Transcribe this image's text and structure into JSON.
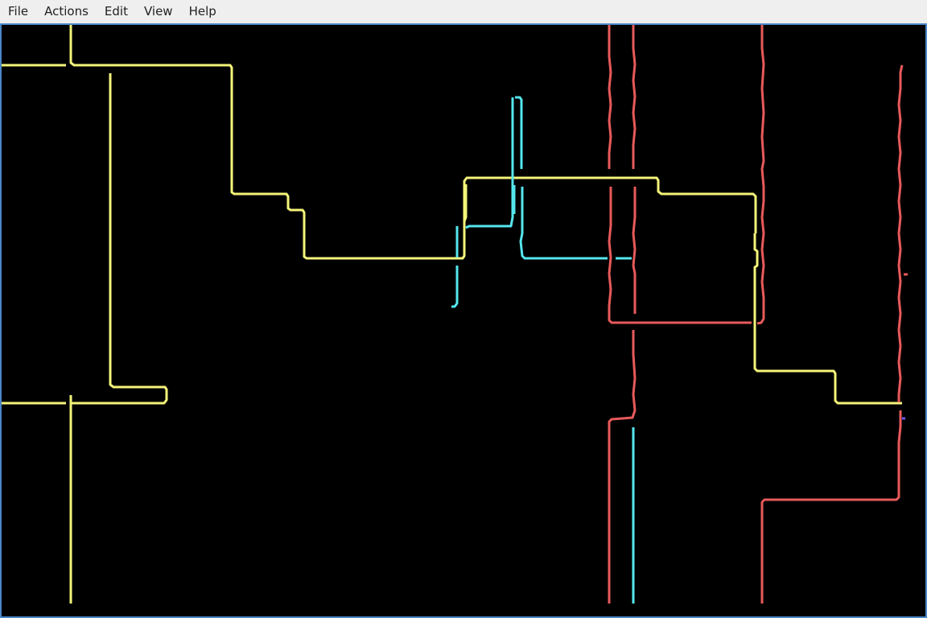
{
  "menubar": {
    "items": [
      {
        "label": "File"
      },
      {
        "label": "Actions"
      },
      {
        "label": "Edit"
      },
      {
        "label": "View"
      },
      {
        "label": "Help"
      }
    ]
  },
  "canvas": {
    "background": "#000000",
    "colors": {
      "yellow": "#f4f47a",
      "cyan": "#55e6ee",
      "red": "#e85a5a",
      "purple": "#7755ee"
    }
  }
}
